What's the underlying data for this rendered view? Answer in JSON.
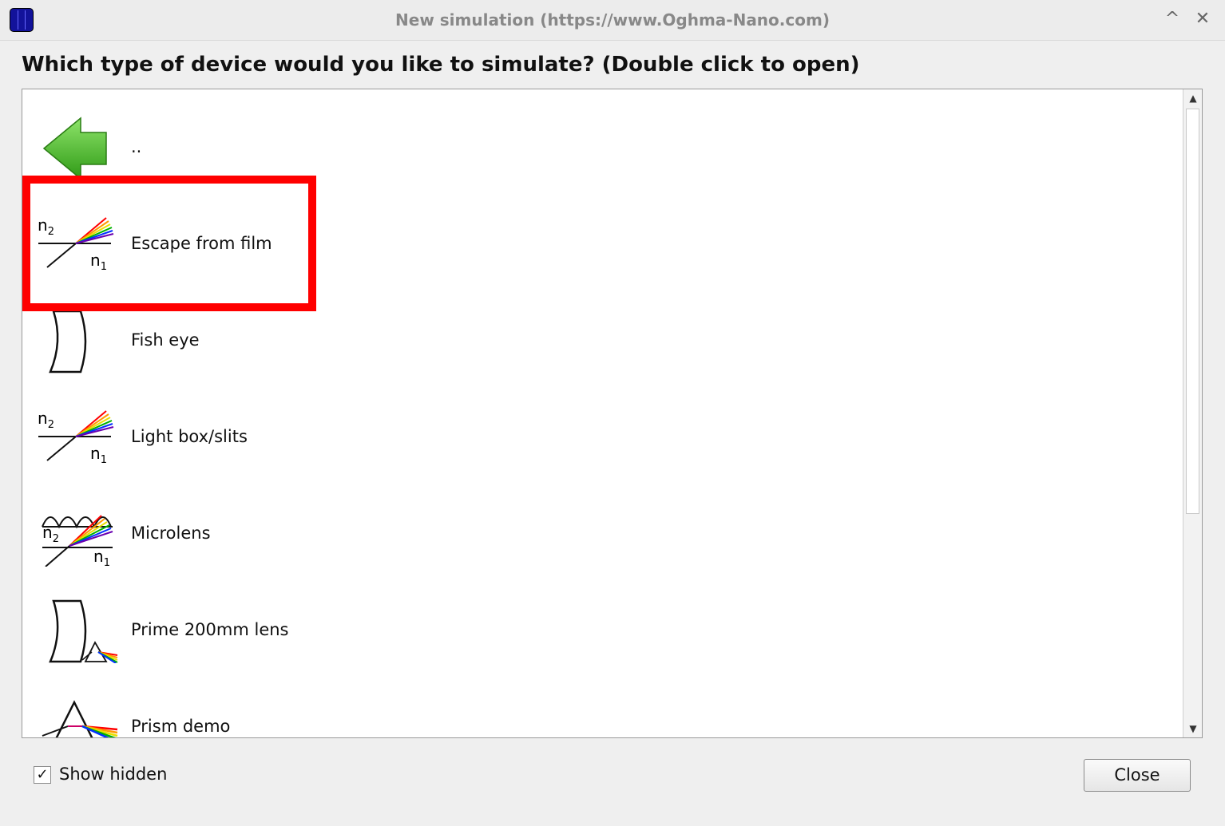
{
  "window": {
    "title": "New simulation (https://www.Oghma-Nano.com)",
    "collapse_glyph": "^",
    "close_glyph": "✕"
  },
  "question": "Which type of device would you like to simulate? (Double click to open)",
  "items": [
    {
      "label": "..",
      "icon": "back-arrow-icon"
    },
    {
      "label": "Escape from film",
      "icon": "refraction-icon",
      "highlighted": true
    },
    {
      "label": "Fish eye",
      "icon": "lens-icon"
    },
    {
      "label": "Light box/slits",
      "icon": "refraction-icon"
    },
    {
      "label": "Microlens",
      "icon": "microlens-icon"
    },
    {
      "label": "Prime 200mm lens",
      "icon": "lens-prism-icon"
    },
    {
      "label": "Prism demo",
      "icon": "prism-icon"
    }
  ],
  "icon_text": {
    "n2": "n",
    "n2_sub": "2",
    "n1": "n",
    "n1_sub": "1"
  },
  "scrollbar": {
    "up_glyph": "▲",
    "down_glyph": "▼"
  },
  "footer": {
    "show_hidden_label": "Show hidden",
    "show_hidden_checked": true,
    "check_glyph": "✓",
    "close_label": "Close"
  },
  "colors": {
    "highlight": "#ff0000",
    "arrow_green": "#3cb01c"
  }
}
